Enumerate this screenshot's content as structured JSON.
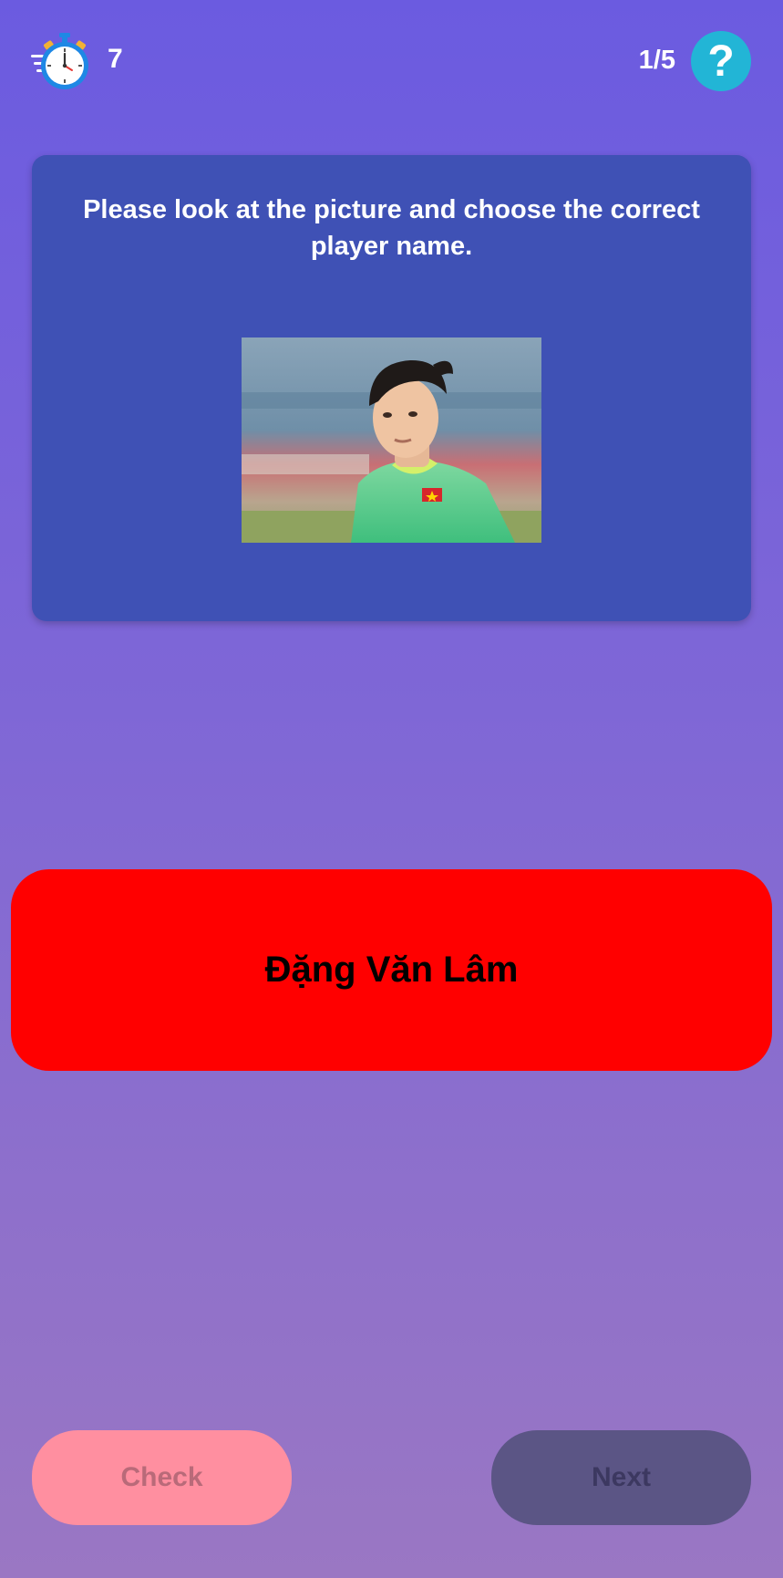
{
  "header": {
    "timer_icon": "stopwatch-icon",
    "timer_count": "7",
    "progress": "1/5",
    "help_icon": "question-mark-icon",
    "help_label": "?"
  },
  "question": {
    "text": "Please look at the picture and choose the correct player name."
  },
  "answer": {
    "label": "Đặng Văn Lâm"
  },
  "buttons": {
    "check_label": "Check",
    "next_label": "Next"
  },
  "colors": {
    "card": "#3f51b5",
    "answer_selected": "#ff0000",
    "check_button": "#ff8fa0",
    "next_button": "#5b5585",
    "help_button": "#22b5d6"
  }
}
